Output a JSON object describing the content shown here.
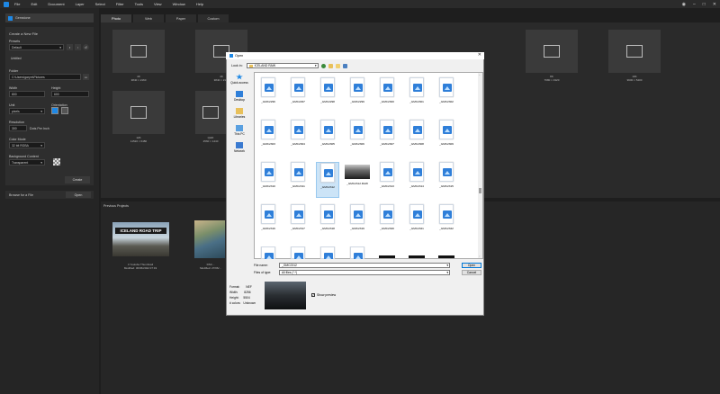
{
  "menubar": {
    "items": [
      "File",
      "Edit",
      "Document",
      "Layer",
      "Select",
      "Filter",
      "Tools",
      "View",
      "Window",
      "Help"
    ],
    "window_controls": [
      "user-icon",
      "minimize",
      "maximize",
      "close"
    ]
  },
  "app": {
    "header_title": "Gemstone"
  },
  "new_file": {
    "title": "Create a New File",
    "presets_label": "Presets",
    "preset_value": "Default",
    "name_value": "Untitled",
    "folder_label": "Folder",
    "folder_value": "C:\\Users\\garym\\Pictures",
    "width_label": "Width",
    "width_value": "800",
    "height_label": "Height",
    "height_value": "600",
    "unit_label": "Unit",
    "unit_value": "pixels",
    "orientation_label": "Orientation",
    "resolution_label": "Resolution",
    "resolution_value": "300",
    "resolution_unit": "Dots Per Inch",
    "color_mode_label": "Color Mode",
    "color_mode_value": "32 bit RGBA",
    "background_label": "Background Content",
    "background_value": "Transparent",
    "create_label": "Create"
  },
  "browse": {
    "label": "Browse for a File",
    "open_label": "Open"
  },
  "tabs": [
    "Photo",
    "Web",
    "Paper",
    "Custom"
  ],
  "presets": [
    {
      "l1": "4K",
      "l2": "3840 × 2160"
    },
    {
      "l1": "4K",
      "l2": "3840 × 2160"
    },
    {
      "l1": "",
      "l2": ""
    },
    {
      "l1": "",
      "l2": ""
    },
    {
      "l1": "",
      "l2": ""
    },
    {
      "l1": "8K",
      "l2": "7680 × 4320"
    },
    {
      "l1": "10K",
      "l2": "9600 × 5400"
    },
    {
      "l1": "12K",
      "l2": "11520 × 6480"
    },
    {
      "l1": "QHD",
      "l2": "2560 × 1440"
    },
    {
      "l1": "LG",
      "l2": "1920 × 1080"
    }
  ],
  "previous": {
    "header": "Previous Projects",
    "p1_name": "4 Youtube Thumbnail",
    "p1_date": "Modified: 30/06/2022 07:19",
    "p1_banner": "ICELAND ROAD TRIP",
    "p2_name": "DSC...",
    "p2_date": "Modified: 27/06/..."
  },
  "dialog": {
    "title": "Open",
    "look_in_label": "Look in:",
    "look_in_value": "ICELAND RAW",
    "places": [
      "Quick access",
      "Desktop",
      "Libraries",
      "This PC",
      "Network"
    ],
    "files": [
      "_GMC2296",
      "_GMC2297",
      "_GMC2298",
      "_GMC2299",
      "_GMC2300",
      "_GMC2301",
      "_GMC2302",
      "_GMC2303",
      "_GMC2304",
      "_GMC2305",
      "_GMC2306",
      "_GMC2307",
      "_GMC2308",
      "_GMC2309",
      "_GMC2310",
      "_GMC2311",
      "_GMC2312",
      "_GMC2312.RAW",
      "_GMC2313",
      "_GMC2314",
      "_GMC2315",
      "_GMC2316",
      "_GMC2317",
      "_GMC2318",
      "_GMC2319",
      "_GMC2320",
      "_GMC2321",
      "_GMC2322"
    ],
    "selected_file": "_GMC2312",
    "file_name_label": "File name:",
    "file_name_value": "_GMC2312",
    "file_type_label": "Files of type:",
    "file_type_value": "All files (*.*)",
    "open_button": "Open",
    "cancel_button": "Cancel",
    "info": {
      "format_label": "Format:",
      "format_value": "NEF",
      "width_label": "Width:",
      "width_value": "8256",
      "height_label": "Height:",
      "height_value": "5504",
      "colors_label": "# colors:",
      "colors_value": "Unknown"
    },
    "show_preview_label": "Show preview"
  },
  "colors": {
    "accent": "#1e88e5",
    "dialog_bg": "#f0f0f0",
    "app_bg": "#1e1e1e"
  }
}
